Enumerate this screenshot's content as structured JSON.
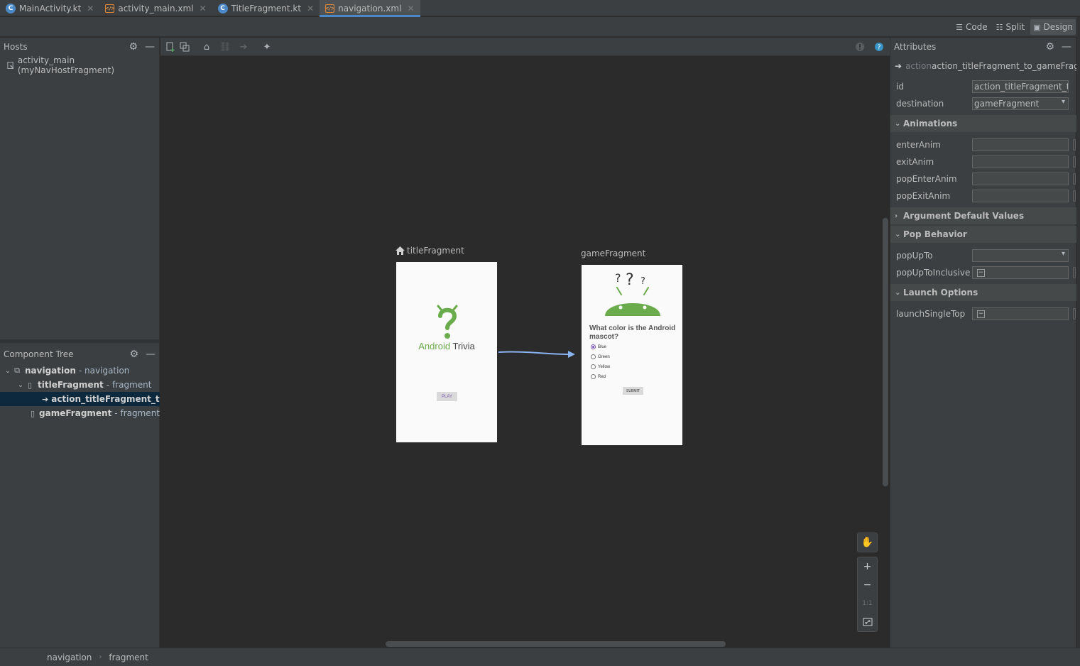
{
  "tabs": [
    {
      "label": "MainActivity.kt",
      "type": "kt",
      "active": false
    },
    {
      "label": "activity_main.xml",
      "type": "xml",
      "active": false
    },
    {
      "label": "TitleFragment.kt",
      "type": "kt",
      "active": false
    },
    {
      "label": "navigation.xml",
      "type": "xml",
      "active": true
    }
  ],
  "view_modes": {
    "code": "Code",
    "split": "Split",
    "design": "Design",
    "active": "Design"
  },
  "hosts": {
    "title": "Hosts",
    "item": "activity_main (myNavHostFragment)"
  },
  "component_tree": {
    "title": "Component Tree",
    "rows": [
      {
        "name": "navigation",
        "type": "- navigation"
      },
      {
        "name": "titleFragment",
        "type": "- fragment"
      },
      {
        "name": "action_titleFragment_to_g",
        "type": ""
      },
      {
        "name": "gameFragment",
        "type": "- fragment"
      }
    ]
  },
  "canvas": {
    "title_fragment": {
      "label": "titleFragment",
      "app_title_a": "Android",
      "app_title_b": "Trivia",
      "play": "PLAY"
    },
    "game_fragment": {
      "label": "gameFragment",
      "question": "What color is the Android mascot?",
      "options": [
        "Blue",
        "Green",
        "Yellow",
        "Red"
      ],
      "selected": "Blue",
      "submit": "SUBMIT"
    },
    "zoom_one_to_one": "1:1"
  },
  "attributes": {
    "title": "Attributes",
    "header_prefix": "action",
    "header_name": "action_titleFragment_to_gameFrag...",
    "id_label": "id",
    "id_value": "action_titleFragment_to_",
    "destination_label": "destination",
    "destination_value": "gameFragment",
    "sections": {
      "animations": "Animations",
      "argument_defaults": "Argument Default Values",
      "pop_behavior": "Pop Behavior",
      "launch_options": "Launch Options"
    },
    "anim_labels": [
      "enterAnim",
      "exitAnim",
      "popEnterAnim",
      "popExitAnim"
    ],
    "pop_up_to_label": "popUpTo",
    "pop_up_to_inclusive_label": "popUpToInclusive",
    "launch_single_top_label": "launchSingleTop"
  },
  "breadcrumb": [
    "navigation",
    "fragment"
  ],
  "colors": {
    "accent": "#4a88c7",
    "android_green": "#6aac4c",
    "action_arrow": "#8ab4f0",
    "selection": "#0d293e"
  }
}
